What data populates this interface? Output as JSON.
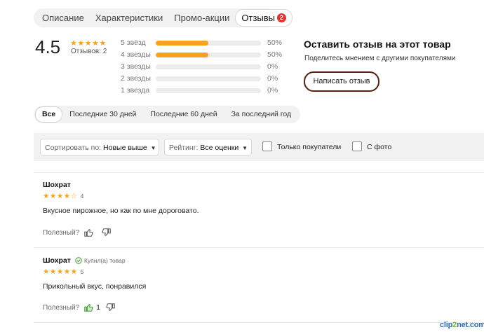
{
  "tabs": [
    {
      "label": "Описание"
    },
    {
      "label": "Характеристики"
    },
    {
      "label": "Промо-акции"
    },
    {
      "label": "Отзывы",
      "badge": "2"
    }
  ],
  "summary": {
    "rating": "4.5",
    "stars": "★★★★★",
    "reviews_count": "Отзывов: 2",
    "distribution": [
      {
        "label": "5 звёзд",
        "percent": "50%",
        "fraction": 0.5
      },
      {
        "label": "4 звезды",
        "percent": "50%",
        "fraction": 0.5
      },
      {
        "label": "3 звезды",
        "percent": "0%",
        "fraction": 0
      },
      {
        "label": "2 звезды",
        "percent": "0%",
        "fraction": 0
      },
      {
        "label": "1 звезда",
        "percent": "0%",
        "fraction": 0
      }
    ]
  },
  "cta": {
    "title": "Оставить отзыв на этот товар",
    "subtitle": "Поделитесь мнением с другими покупателями",
    "button": "Написать отзыв"
  },
  "time_filters": [
    {
      "label": "Все"
    },
    {
      "label": "Последние 30 дней"
    },
    {
      "label": "Последние 60 дней"
    },
    {
      "label": "За последний год"
    }
  ],
  "filters": {
    "sort_key": "Сортировать по:",
    "sort_value": "Новые выше",
    "rating_key": "Рейтинг:",
    "rating_value": "Все оценки",
    "buyers_only": "Только покупатели",
    "with_photo": "С фото"
  },
  "reviews": [
    {
      "author": "Шохрат",
      "stars": "★★★★☆",
      "score": "4",
      "text": "Вкусное пирожное, но как по мне дороговато.",
      "helpful_label": "Полезный?",
      "likes": ""
    },
    {
      "author": "Шохрат",
      "verified": "Купил(а) товар",
      "stars": "★★★★★",
      "score": "5",
      "text": "Прикольный вкус, понравился",
      "helpful_label": "Полезный?",
      "likes": "1"
    }
  ],
  "watermark": {
    "left": "clip",
    "mid": "2",
    "right": "net.com"
  },
  "colors": {
    "star": "#f5a31a",
    "badge": "#e5322d",
    "button_border": "#5a1f0e",
    "like_active": "#3a9a2e"
  }
}
